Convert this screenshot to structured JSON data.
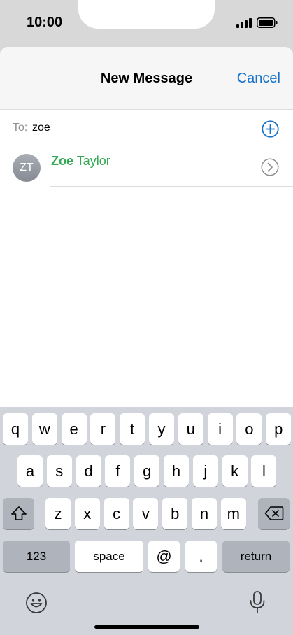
{
  "status": {
    "time": "10:00"
  },
  "header": {
    "title": "New Message",
    "cancel_label": "Cancel"
  },
  "recipient": {
    "label": "To:",
    "value": "zoe"
  },
  "suggestion": {
    "initials": "ZT",
    "first_name": "Zoe",
    "last_name": "Taylor"
  },
  "keyboard": {
    "row1": [
      "q",
      "w",
      "e",
      "r",
      "t",
      "y",
      "u",
      "i",
      "o",
      "p"
    ],
    "row2": [
      "a",
      "s",
      "d",
      "f",
      "g",
      "h",
      "j",
      "k",
      "l"
    ],
    "row3": [
      "z",
      "x",
      "c",
      "v",
      "b",
      "n",
      "m"
    ],
    "numbers_label": "123",
    "space_label": "space",
    "at_label": "@",
    "dot_label": ".",
    "return_label": "return"
  },
  "icons": {
    "add": "plus-circle-icon",
    "chevron": "chevron-right-circle-icon",
    "shift": "shift-icon",
    "delete": "backspace-icon",
    "emoji": "emoji-icon",
    "mic": "microphone-icon"
  },
  "colors": {
    "accent": "#1a73c9",
    "match": "#34a853"
  }
}
